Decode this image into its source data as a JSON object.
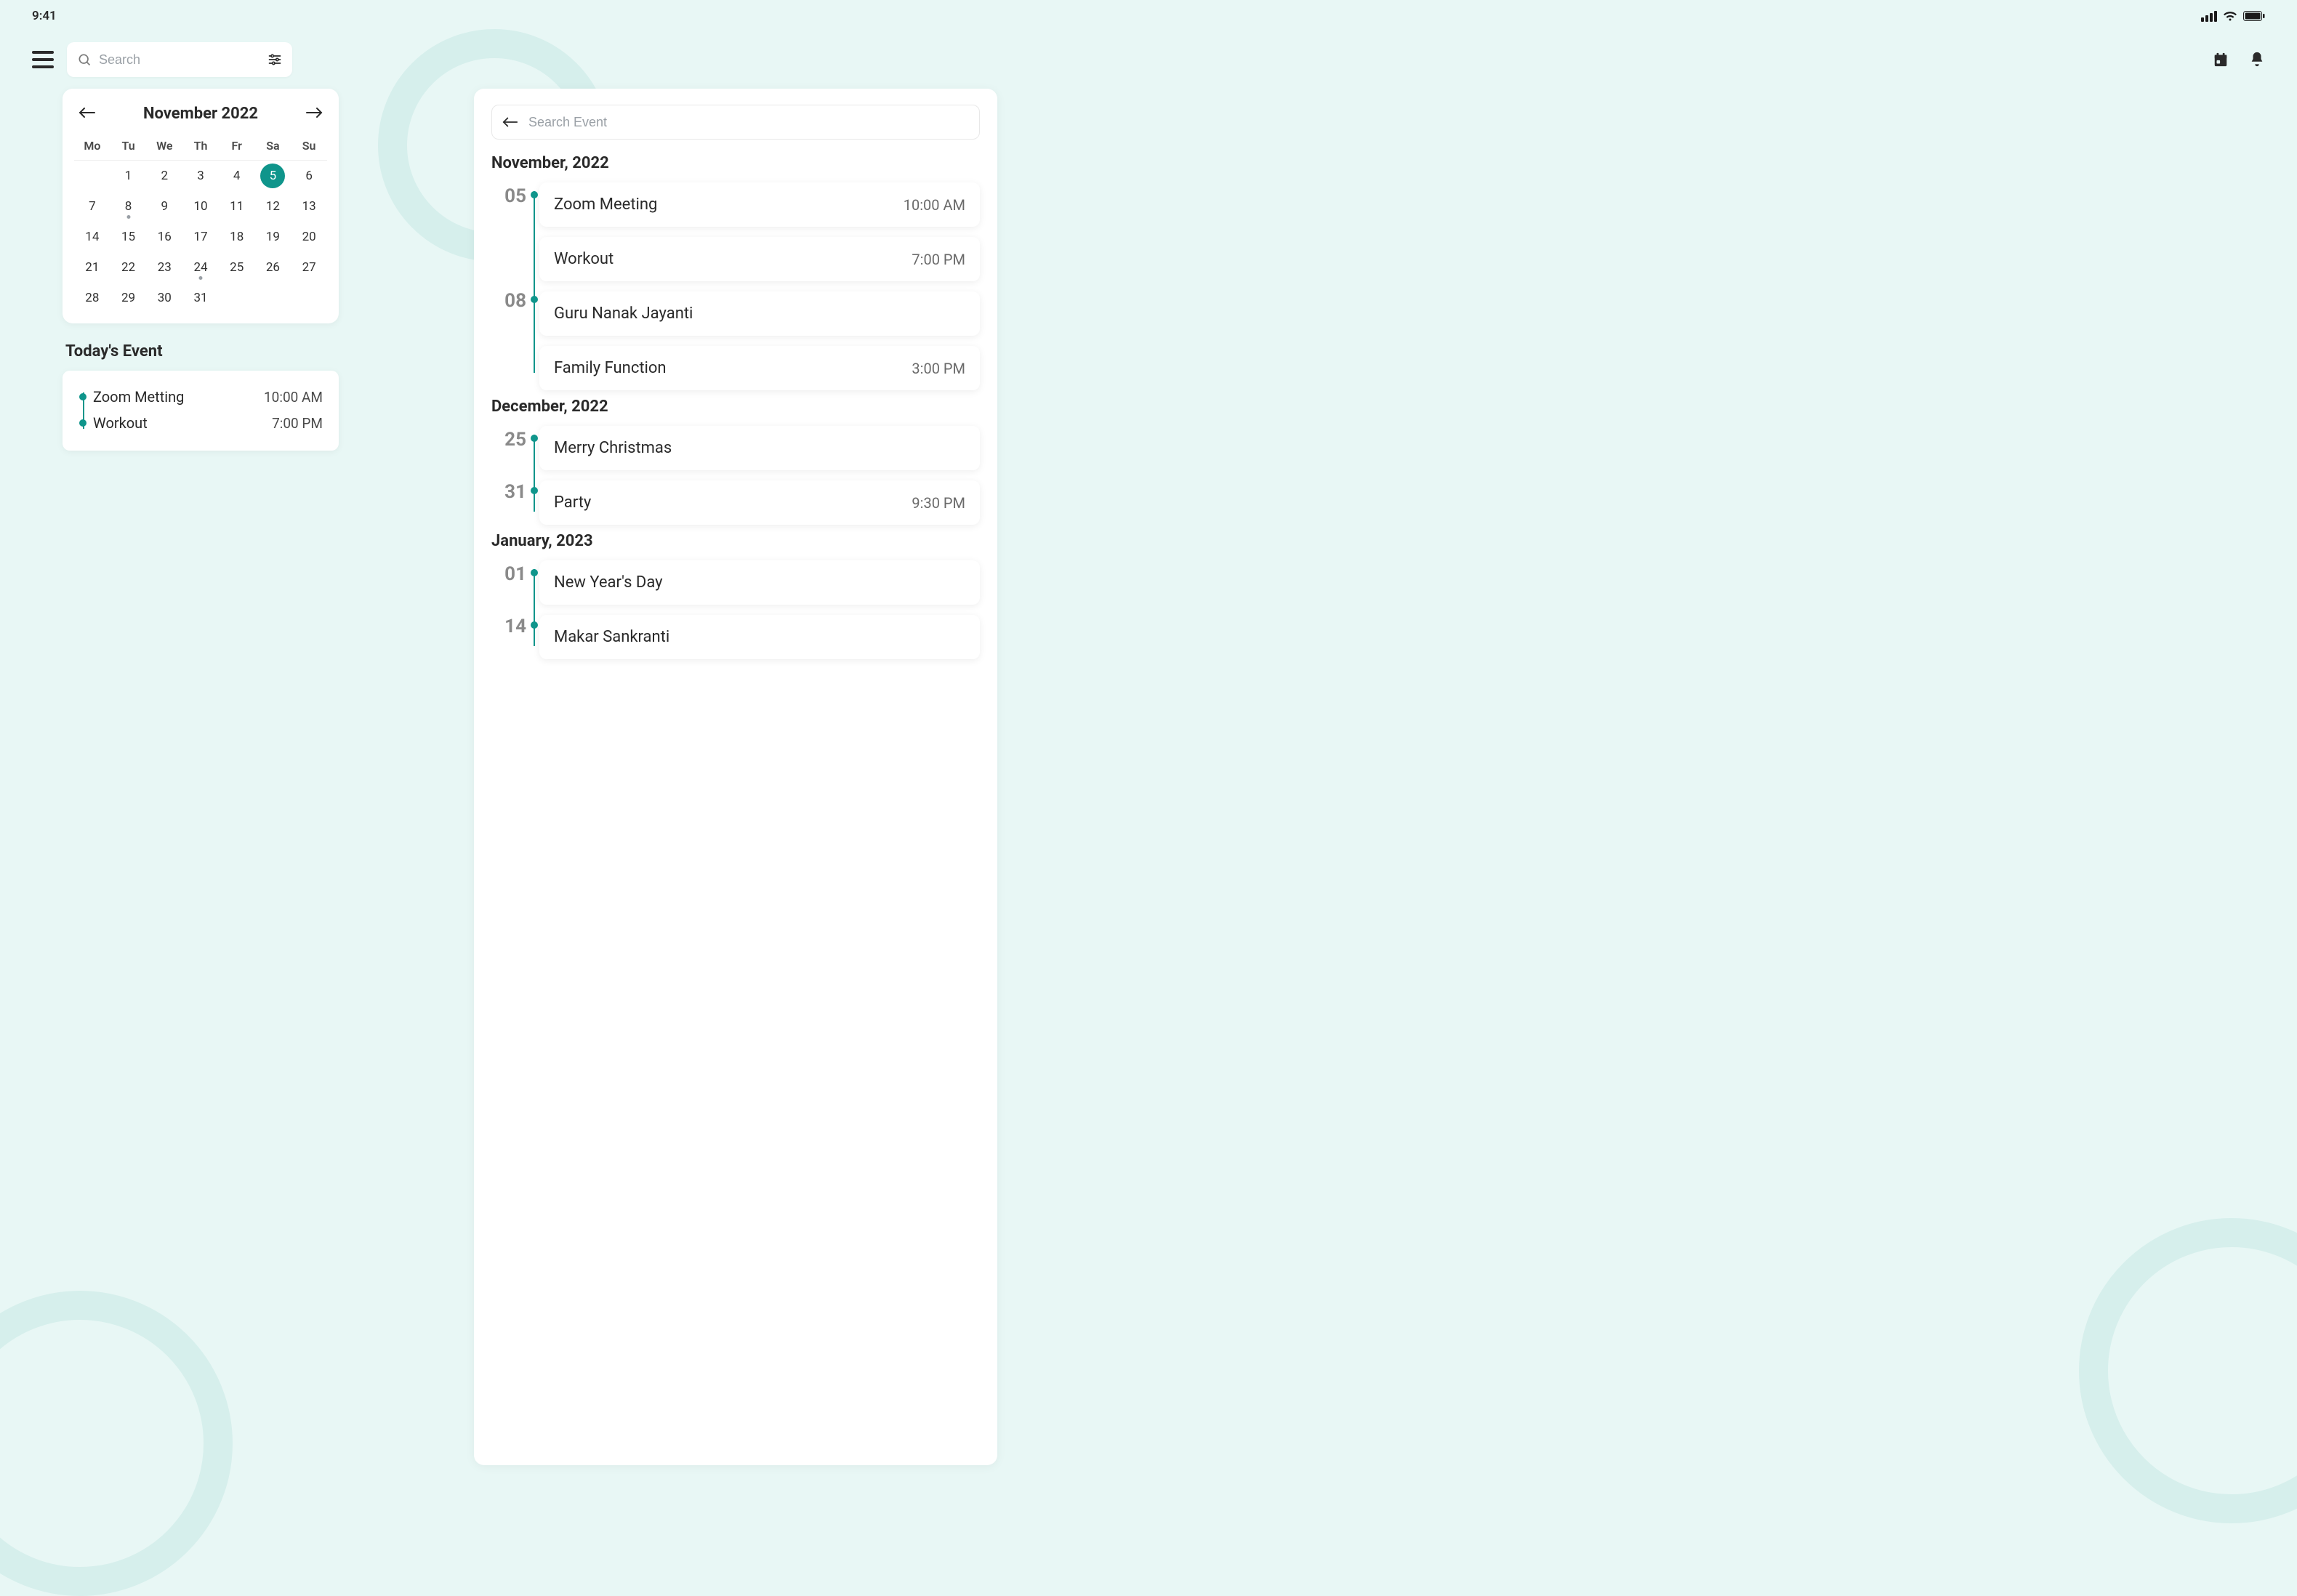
{
  "status": {
    "time": "9:41"
  },
  "search": {
    "placeholder": "Search"
  },
  "calendar": {
    "month_label": "November 2022",
    "dow": [
      "Mo",
      "Tu",
      "We",
      "Th",
      "Fr",
      "Sa",
      "Su"
    ],
    "weeks": [
      [
        "",
        "",
        "1",
        "2",
        "3",
        "4",
        "5",
        "6"
      ],
      [
        "7",
        "8",
        "9",
        "10",
        "11",
        "12",
        "13"
      ],
      [
        "14",
        "15",
        "16",
        "17",
        "18",
        "19",
        "20"
      ],
      [
        "21",
        "22",
        "23",
        "24",
        "25",
        "26",
        "27"
      ],
      [
        "28",
        "29",
        "30",
        "31",
        "",
        "",
        ""
      ]
    ],
    "selected_day": "5",
    "dot_days": [
      "8",
      "24"
    ]
  },
  "today": {
    "title": "Today's Event",
    "items": [
      {
        "name": "Zoom Metting",
        "time": "10:00 AM"
      },
      {
        "name": "Workout",
        "time": "7:00 PM"
      }
    ]
  },
  "event_search": {
    "placeholder": "Search Event"
  },
  "months": [
    {
      "label": "November, 2022",
      "groups": [
        {
          "day": "05",
          "events": [
            {
              "title": "Zoom Meeting",
              "time": "10:00 AM"
            },
            {
              "title": "Workout",
              "time": "7:00 PM"
            }
          ]
        },
        {
          "day": "08",
          "events": [
            {
              "title": "Guru Nanak Jayanti",
              "time": ""
            },
            {
              "title": "Family Function",
              "time": "3:00 PM"
            }
          ]
        }
      ]
    },
    {
      "label": "December, 2022",
      "groups": [
        {
          "day": "25",
          "events": [
            {
              "title": "Merry Christmas",
              "time": ""
            }
          ]
        },
        {
          "day": "31",
          "events": [
            {
              "title": "Party",
              "time": "9:30 PM"
            }
          ]
        }
      ]
    },
    {
      "label": "January, 2023",
      "groups": [
        {
          "day": "01",
          "events": [
            {
              "title": "New Year's Day",
              "time": ""
            }
          ]
        },
        {
          "day": "14",
          "events": [
            {
              "title": "Makar Sankranti",
              "time": ""
            }
          ]
        }
      ]
    }
  ]
}
